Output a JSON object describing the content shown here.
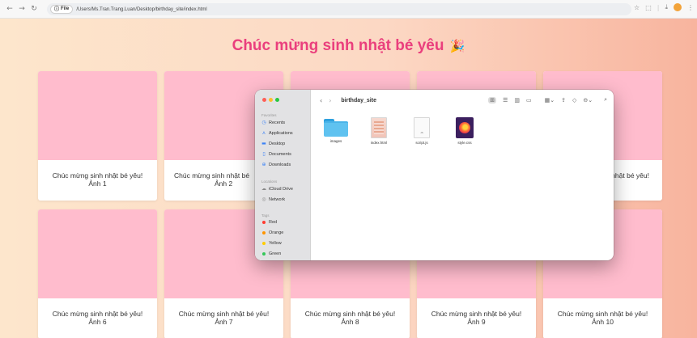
{
  "browser": {
    "scheme_label": "File",
    "url": "/Users/Ms.Tran.Trang.Luan/Desktop/birthday_site/index.html",
    "nav_icons": [
      "back-arrow-icon",
      "forward-arrow-icon",
      "reload-icon"
    ],
    "right_icons": [
      "star-icon",
      "extensions-icon",
      "download-icon",
      "profile-icon",
      "menu-icon"
    ]
  },
  "page": {
    "title": "Chúc mừng sinh nhật bé yêu",
    "title_emoji": "🎉",
    "accent_color": "#ea3f7d",
    "card_image_color": "#ffbccd",
    "cards_row1": [
      {
        "line1": "Chúc mừng sinh nhật bé yêu!",
        "line2": "Ảnh 1"
      },
      {
        "line1": "Chúc mừng sinh nhật bé",
        "line2": "Ảnh 2"
      },
      {
        "line1": "",
        "line2": ""
      },
      {
        "line1": "",
        "line2": ""
      },
      {
        "line1": "nhật bé yêu!",
        "line2": ""
      }
    ],
    "cards_row2": [
      {
        "line1": "Chúc mừng sinh nhật bé yêu!",
        "line2": "Ảnh 6"
      },
      {
        "line1": "Chúc mừng sinh nhật bé yêu!",
        "line2": "Ảnh 7"
      },
      {
        "line1": "Chúc mừng sinh nhật bé yêu!",
        "line2": "Ảnh 8"
      },
      {
        "line1": "Chúc mừng sinh nhật bé yêu!",
        "line2": "Ảnh 9"
      },
      {
        "line1": "Chúc mừng sinh nhật bé yêu!",
        "line2": "Ảnh 10"
      }
    ]
  },
  "finder": {
    "folder_title": "birthday_site",
    "sidebar": {
      "favorites_label": "Favorites",
      "favorites": [
        {
          "label": "Recents",
          "icon": "clock-icon"
        },
        {
          "label": "Applications",
          "icon": "applications-icon"
        },
        {
          "label": "Desktop",
          "icon": "desktop-icon"
        },
        {
          "label": "Documents",
          "icon": "document-icon"
        },
        {
          "label": "Downloads",
          "icon": "download-icon"
        }
      ],
      "locations_label": "Locations",
      "locations": [
        {
          "label": "iCloud Drive",
          "icon": "cloud-icon"
        },
        {
          "label": "Network",
          "icon": "network-icon"
        }
      ],
      "tags_label": "Tags",
      "tags": [
        {
          "label": "Red",
          "color": "#ff3b30"
        },
        {
          "label": "Orange",
          "color": "#ff9500"
        },
        {
          "label": "Yellow",
          "color": "#ffcc00"
        },
        {
          "label": "Green",
          "color": "#34c759"
        }
      ]
    },
    "files": [
      {
        "name": "images",
        "kind": "folder"
      },
      {
        "name": "index.html",
        "kind": "html"
      },
      {
        "name": "script.js",
        "kind": "js",
        "ext": "JS"
      },
      {
        "name": "style.css",
        "kind": "css"
      }
    ]
  }
}
